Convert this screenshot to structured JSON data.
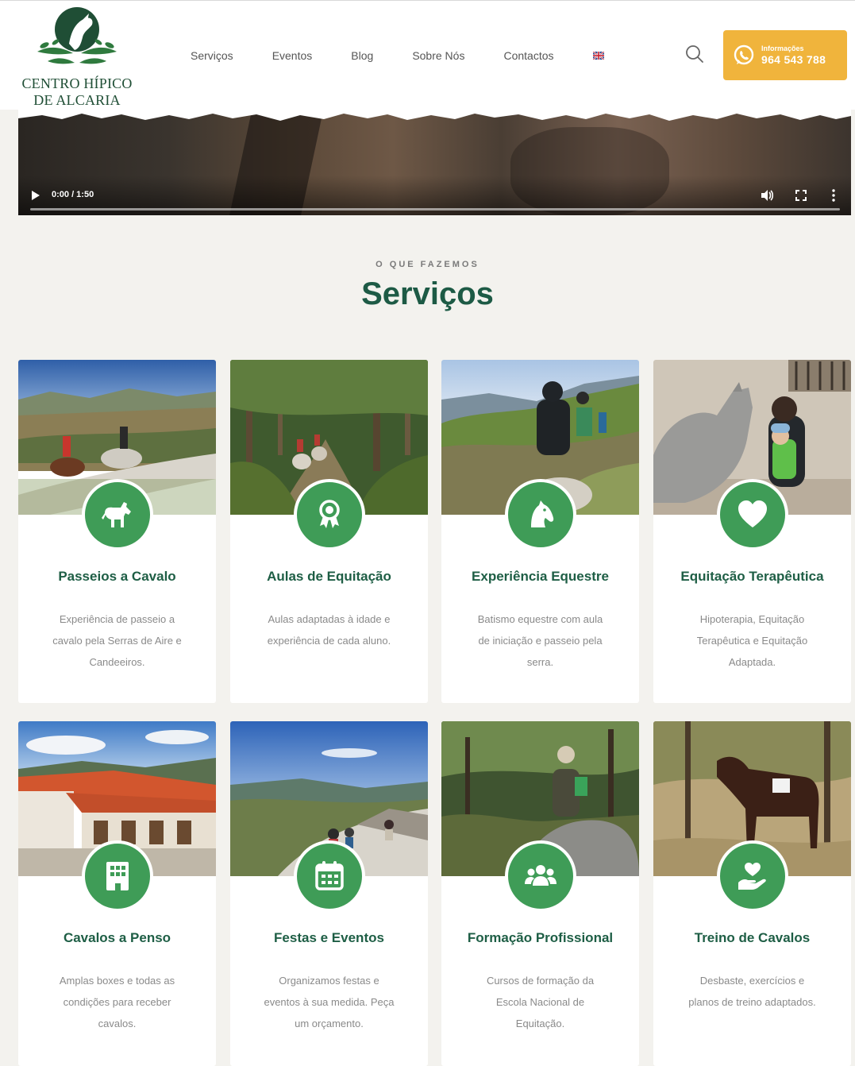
{
  "header": {
    "logo_line1": "CENTRO HÍPICO",
    "logo_line2": "DE ALCARIA",
    "nav": [
      "Serviços",
      "Eventos",
      "Blog",
      "Sobre Nós",
      "Contactos"
    ],
    "language_flag": "uk-flag-icon",
    "search_icon": "search-icon",
    "cta_label": "Informações",
    "cta_phone": "964 543 788",
    "cta_icon": "whatsapp-icon",
    "cta_color": "#f0b43c"
  },
  "video": {
    "time": "0:00 / 1:50",
    "progress": 0,
    "icons": [
      "play-icon",
      "volume-icon",
      "fullscreen-icon",
      "more-options-icon"
    ]
  },
  "section": {
    "eyebrow": "O QUE FAZEMOS",
    "title": "Serviços"
  },
  "colors": {
    "accent_green": "#3f9c57",
    "heading_green": "#1d5a45",
    "background": "#f3f2ee"
  },
  "services": [
    {
      "title": "Passeios a Cavalo",
      "desc": "Experiência de passeio a cavalo pela Serras de Aire e Candeeiros.",
      "icon": "horse-icon"
    },
    {
      "title": "Aulas de Equitação",
      "desc": "Aulas adaptadas à idade e experiência de cada aluno.",
      "icon": "award-icon"
    },
    {
      "title": "Experiência Equestre",
      "desc": "Batismo equestre com aula de iniciação e passeio pela serra.",
      "icon": "horse-head-icon"
    },
    {
      "title": "Equitação Terapêutica",
      "desc": "Hipoterapia, Equitação Terapêutica e Equitação Adaptada.",
      "icon": "heart-icon"
    },
    {
      "title": "Cavalos a Penso",
      "desc": "Amplas boxes e todas as condições para receber cavalos.",
      "icon": "building-icon"
    },
    {
      "title": "Festas e Eventos",
      "desc": "Organizamos festas e eventos à sua medida. Peça um orçamento.",
      "icon": "calendar-icon"
    },
    {
      "title": "Formação Profissional",
      "desc": "Cursos de formação da Escola Nacional de Equitação.",
      "icon": "group-icon"
    },
    {
      "title": "Treino de Cavalos",
      "desc": "Desbaste, exercícios e planos de treino adaptados.",
      "icon": "hand-heart-icon"
    }
  ]
}
